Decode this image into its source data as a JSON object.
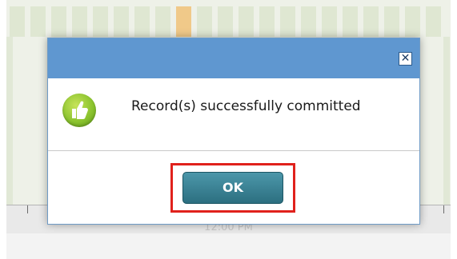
{
  "background": {
    "time_label": "12:00 PM"
  },
  "dialog": {
    "close_glyph": "✕",
    "message": "Record(s) successfully committed",
    "icon": "thumbs-up-icon",
    "ok_label": "OK",
    "colors": {
      "titlebar": "#5f97d0",
      "ok_button": "#2c6f80",
      "focus_outline": "#e0211c",
      "success_icon": "#8cc42f"
    }
  }
}
